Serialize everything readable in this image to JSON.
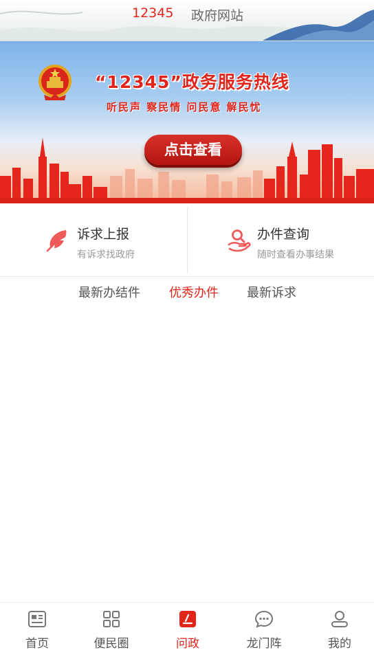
{
  "top_tabs": [
    {
      "label": "12345",
      "active": true
    },
    {
      "label": "政府网站",
      "active": false
    }
  ],
  "banner": {
    "title": "“12345”政务服务热线",
    "slogan": "听民声 察民情 问民意 解民忧",
    "button_label": "点击查看",
    "emblem_icon": "national-emblem-icon"
  },
  "actions": [
    {
      "title": "诉求上报",
      "subtitle": "有诉求找政府",
      "icon": "feather-pen-icon"
    },
    {
      "title": "办件查询",
      "subtitle": "随时查看办事结果",
      "icon": "hand-search-icon"
    }
  ],
  "segment_tabs": [
    {
      "label": "最新办结件",
      "active": false
    },
    {
      "label": "优秀办件",
      "active": true
    },
    {
      "label": "最新诉求",
      "active": false
    }
  ],
  "bottom_nav": [
    {
      "label": "首页",
      "icon": "news-icon",
      "active": false
    },
    {
      "label": "便民圈",
      "icon": "grid-icon",
      "active": false
    },
    {
      "label": "问政",
      "icon": "edit-icon",
      "active": true
    },
    {
      "label": "龙门阵",
      "icon": "chat-bubble-icon",
      "active": false
    },
    {
      "label": "我的",
      "icon": "user-icon",
      "active": false
    }
  ],
  "colors": {
    "accent": "#e1251b",
    "text": "#333333",
    "muted": "#9a9a9a"
  }
}
